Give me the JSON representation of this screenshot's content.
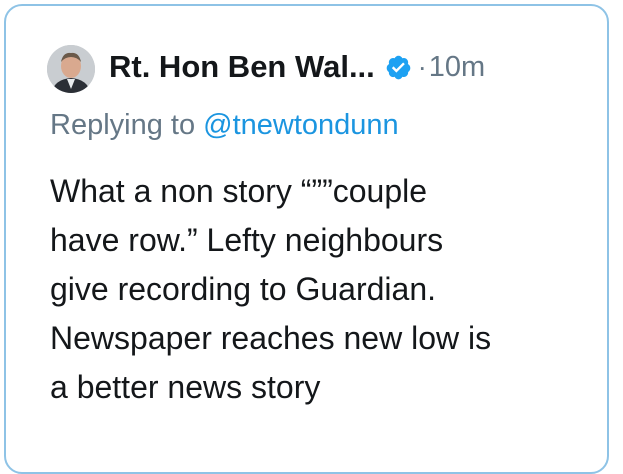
{
  "tweet": {
    "author_name": "Rt. Hon Ben Wal...",
    "timestamp": "10m",
    "separator": "·",
    "reply_prefix": "Replying to",
    "reply_handle": "@tnewtondunn",
    "body_lines": [
      "What a non story “””couple",
      "have row.” Lefty neighbours",
      "give recording to Guardian.",
      "Newspaper reaches new low is",
      "a better news story"
    ]
  },
  "icons": {
    "avatar": "profile-photo",
    "verified": "verified-badge-icon"
  },
  "colors": {
    "border": "#8ec3e6",
    "link": "#1b95e0",
    "muted": "#657786",
    "text": "#14171a"
  }
}
